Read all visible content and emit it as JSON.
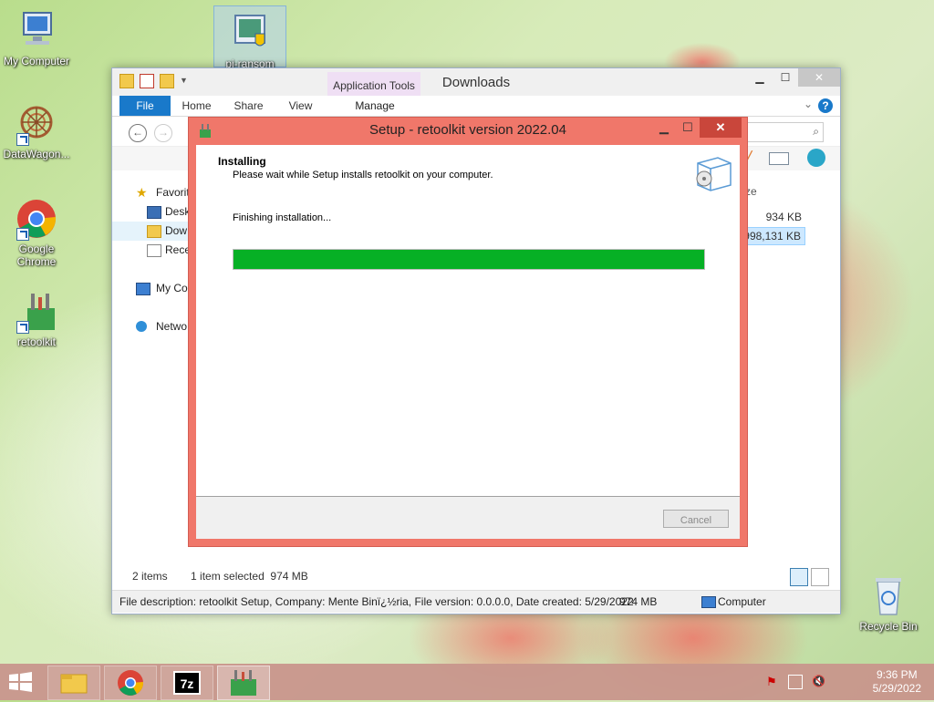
{
  "desktop": {
    "icons": [
      {
        "label": "My Computer"
      },
      {
        "label": "DataWagon..."
      },
      {
        "label": "Google Chrome"
      },
      {
        "label": "retoolkit"
      },
      {
        "label": "pi-ransom"
      },
      {
        "label": "Recycle Bin"
      }
    ]
  },
  "explorer": {
    "title": "Downloads",
    "context_tab_group": "Application Tools",
    "tabs": {
      "file": "File",
      "home": "Home",
      "share": "Share",
      "view": "View",
      "manage": "Manage"
    },
    "nav": [
      "Favorit",
      "Desk",
      "Dow",
      "Rece",
      "My Co",
      "Netwo"
    ],
    "column_header": "ze",
    "sizes": [
      "934 KB",
      "998,131 KB"
    ],
    "status": {
      "items": "2 items",
      "selected": "1 item selected  974 MB"
    },
    "details": {
      "description": "File description: retoolkit Setup, Company: Mente Binï¿½ria, File version: 0.0.0.0, Date created: 5/29/2022",
      "size": "974 MB",
      "location": "Computer"
    }
  },
  "setup": {
    "title": "Setup - retoolkit version 2022.04",
    "heading": "Installing",
    "subheading": "Please wait while Setup installs retoolkit on your computer.",
    "status": "Finishing installation...",
    "progress": 1.0,
    "cancel_label": "Cancel"
  },
  "taskbar": {
    "clock_time": "9:36 PM",
    "clock_date": "5/29/2022"
  },
  "colors": {
    "dialog_frame": "#f0776a",
    "progress": "#06b025",
    "ribbon_file": "#1979ca"
  }
}
